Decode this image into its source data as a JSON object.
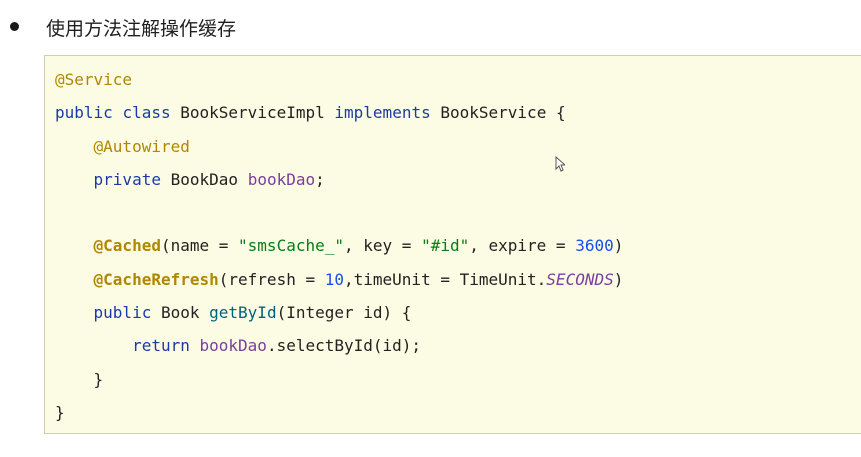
{
  "heading": "使用方法注解操作缓存",
  "code": {
    "line1": {
      "ann": "@Service"
    },
    "line2": {
      "kw1": "public",
      "kw2": "class",
      "name": "BookServiceImpl",
      "kw3": "implements",
      "iface": "BookService",
      "brace": "{"
    },
    "line3": {
      "ann": "@Autowired"
    },
    "line4": {
      "kw": "private",
      "type": "BookDao",
      "field": "bookDao",
      "semi": ";"
    },
    "line6": {
      "ann": "@Cached",
      "p1": "(name = ",
      "s1": "\"smsCache_\"",
      "p2": ", key = ",
      "s2": "\"#id\"",
      "p3": ", expire = ",
      "n1": "3600",
      "p4": ")"
    },
    "line7": {
      "ann": "@CacheRefresh",
      "p1": "(refresh = ",
      "n1": "10",
      "p2": ",timeUnit = TimeUnit.",
      "sf": "SECONDS",
      "p3": ")"
    },
    "line8": {
      "kw": "public",
      "type": "Book",
      "method": "getById",
      "rest": "(Integer id) {"
    },
    "line9": {
      "kw": "return",
      "field": "bookDao",
      "rest": ".selectById(id);"
    },
    "line10": {
      "brace": "}"
    },
    "line11": {
      "brace": "}"
    }
  }
}
